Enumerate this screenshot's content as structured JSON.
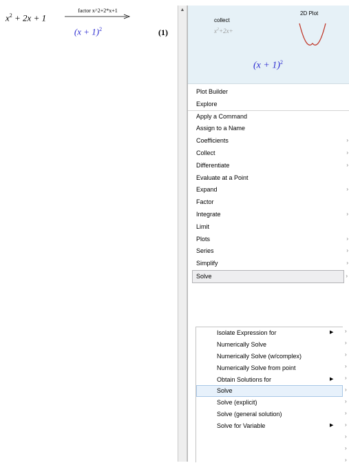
{
  "worksheet": {
    "input_base": "x",
    "input_exp": "2",
    "input_rest": "+ 2x + 1",
    "arrow_label": "factor x^2+2*x+1",
    "result_base": "(x + 1)",
    "result_exp": "2",
    "equation_number": "(1)"
  },
  "scrollbar": {
    "up_glyph": "▲"
  },
  "preview": {
    "collect_label": "collect",
    "collect_expr_base": "x",
    "collect_expr_exp": "2",
    "collect_expr_rest": "+2x+",
    "plot_label": "2D Plot",
    "result_base": "(x + 1)",
    "result_exp": "2"
  },
  "menu": {
    "items": [
      {
        "label": "Plot Builder",
        "submenu": false
      },
      {
        "label": "Explore",
        "submenu": false
      },
      {
        "label": "Apply a Command",
        "submenu": false
      },
      {
        "label": "Assign to a Name",
        "submenu": false
      },
      {
        "label": "Coefficients",
        "submenu": true
      },
      {
        "label": "Collect",
        "submenu": true
      },
      {
        "label": "Differentiate",
        "submenu": true
      },
      {
        "label": "Evaluate at a Point",
        "submenu": false
      },
      {
        "label": "Expand",
        "submenu": true
      },
      {
        "label": "Factor",
        "submenu": false
      },
      {
        "label": "Integrate",
        "submenu": true
      },
      {
        "label": "Limit",
        "submenu": false
      },
      {
        "label": "Plots",
        "submenu": true
      },
      {
        "label": "Series",
        "submenu": true
      },
      {
        "label": "Simplify",
        "submenu": true
      },
      {
        "label": "Solve",
        "submenu": true
      }
    ],
    "chevron_glyph": "›"
  },
  "submenu": {
    "items": [
      {
        "label": "Isolate Expression for",
        "has_children": true
      },
      {
        "label": "Numerically Solve",
        "has_children": false
      },
      {
        "label": "Numerically Solve (w/complex)",
        "has_children": false
      },
      {
        "label": "Numerically Solve from point",
        "has_children": false
      },
      {
        "label": "Obtain Solutions for",
        "has_children": true
      },
      {
        "label": "Solve",
        "has_children": false
      },
      {
        "label": "Solve (explicit)",
        "has_children": false
      },
      {
        "label": "Solve (general solution)",
        "has_children": false
      },
      {
        "label": "Solve for Variable",
        "has_children": true
      }
    ],
    "selected_index": 5,
    "triangle_glyph": "▶"
  },
  "colors": {
    "result_blue": "#2a2ad0",
    "preview_bg": "#e6f1f7",
    "plot_curve": "#c0392b",
    "selection_bg": "#e7f1fb"
  },
  "icons": {
    "scroll_up": "scroll-up-icon",
    "submenu_chevron": "chevron-right-icon",
    "submenu_triangle": "triangle-right-icon"
  }
}
